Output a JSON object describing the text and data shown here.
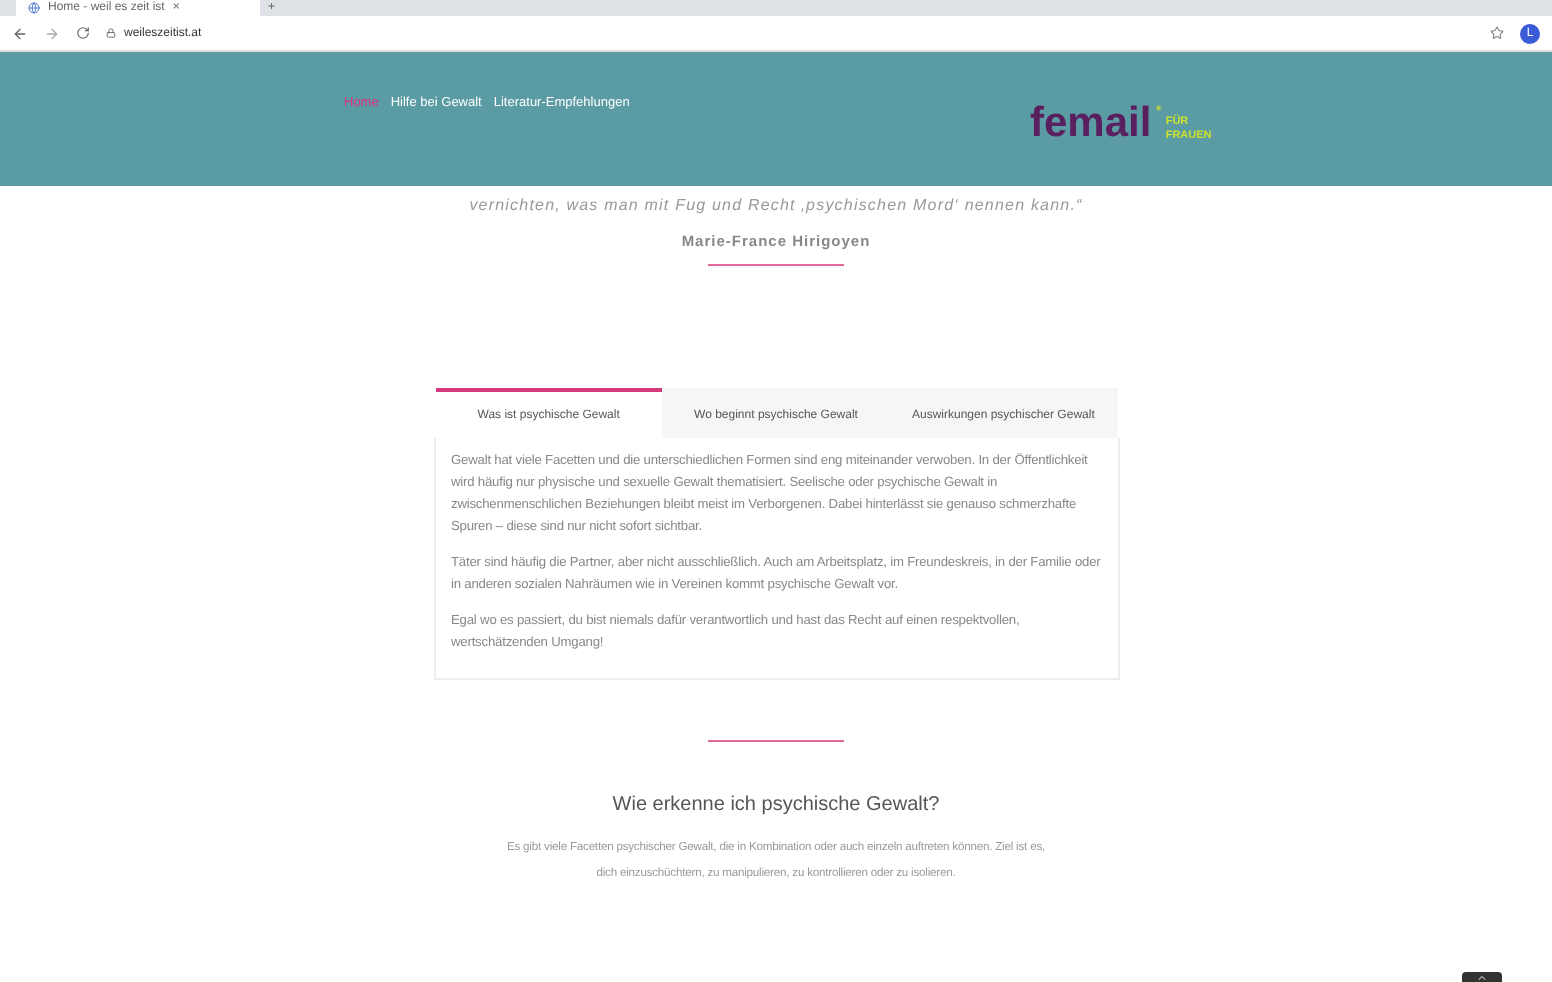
{
  "browser": {
    "tab_title": "Home - weil es zeit ist",
    "tab_close": "×",
    "new_tab": "+",
    "url": "weileszeitist.at",
    "profile_initial": "L"
  },
  "nav": {
    "items": [
      {
        "label": "Home",
        "selected": true
      },
      {
        "label": "Hilfe bei Gewalt",
        "selected": false
      },
      {
        "label": "Literatur-Empfehlungen",
        "selected": false
      }
    ]
  },
  "logo": {
    "word": "femail",
    "star": "*",
    "line1": "FÜR",
    "line2": "FRAUEN"
  },
  "quote": {
    "text": "vernichten, was man mit Fug und Recht ‚psychischen Mord‘ nennen kann.“",
    "author": "Marie-France Hirigoyen"
  },
  "tabs": [
    {
      "label": "Was ist psychische Gewalt",
      "selected": true
    },
    {
      "label": "Wo beginnt psychische Gewalt",
      "selected": false
    },
    {
      "label": "Auswirkungen psychischer Gewalt",
      "selected": false
    }
  ],
  "panel": {
    "paragraphs": [
      "Gewalt hat viele Facetten und die unterschiedlichen Formen sind eng miteinander verwoben. In der Öffentlichkeit wird häufig nur physische und sexuelle Gewalt thematisiert. Seelische oder psychische Gewalt in zwischenmenschlichen Beziehungen bleibt meist im Verborgenen. Dabei hinterlässt sie genauso schmerzhafte Spuren – diese sind nur nicht sofort sichtbar.",
      "Täter sind häufig die Partner, aber nicht ausschließlich. Auch am Arbeitsplatz, im Freundeskreis, in der Familie oder in anderen sozialen Nahräumen wie in Vereinen kommt psychische Gewalt vor.",
      "Egal wo es passiert, du bist niemals dafür verantwortlich und hast das Recht auf einen respektvollen, wertschätzenden Umgang!"
    ]
  },
  "section": {
    "heading": "Wie erkenne ich psychische Gewalt?",
    "lines": [
      "Es gibt viele Facetten psychischer Gewalt, die in Kombination oder auch einzeln auftreten können. Ziel ist es,",
      "dich einzuschüchtern, zu manipulieren, zu kontrollieren oder zu isolieren."
    ]
  }
}
